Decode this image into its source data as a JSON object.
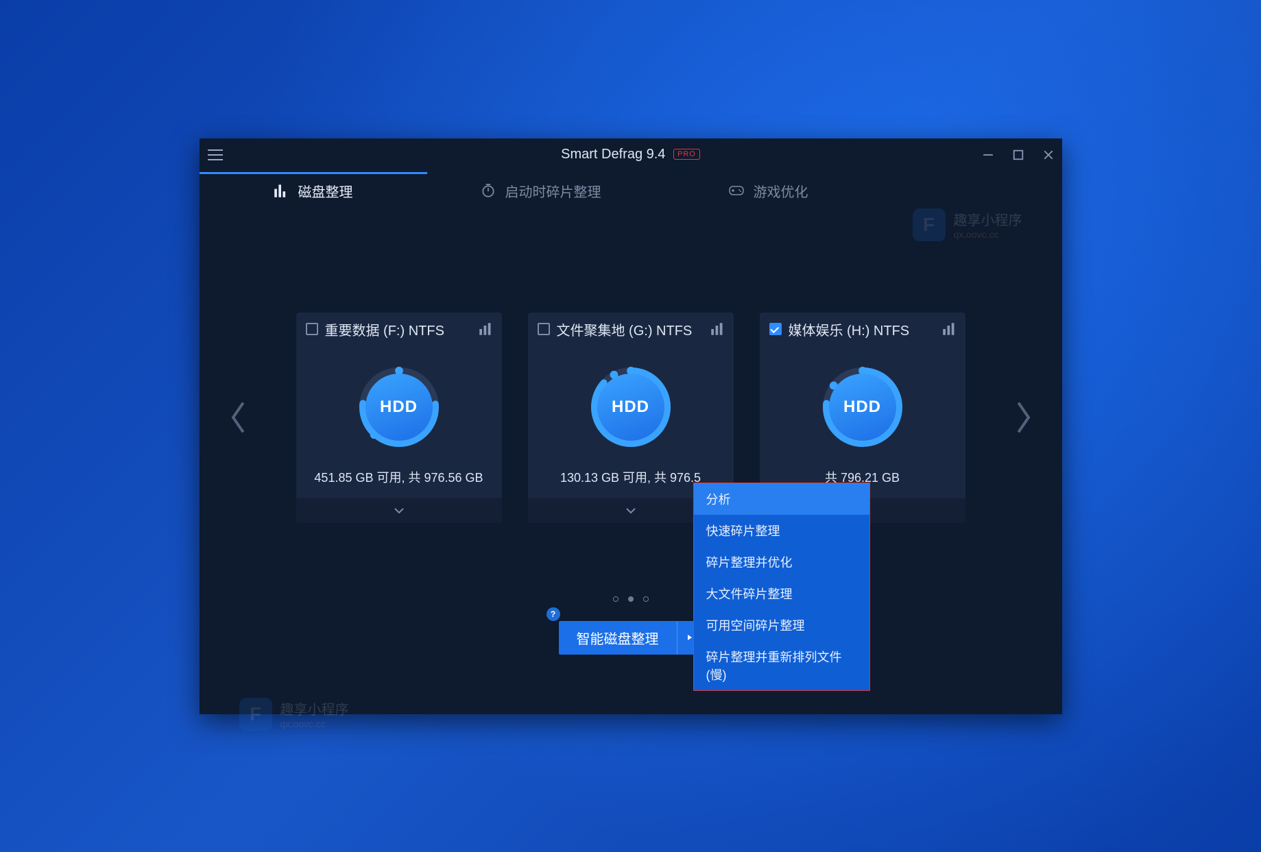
{
  "title": {
    "name": "Smart Defrag 9.4",
    "badge": "PRO"
  },
  "tabs": [
    {
      "label": "磁盘整理"
    },
    {
      "label": "启动时碎片整理"
    },
    {
      "label": "游戏优化"
    }
  ],
  "disks": [
    {
      "checked": false,
      "name": "重要数据 (F:) NTFS",
      "type": "HDD",
      "usage": "451.85 GB 可用, 共 976.56 GB"
    },
    {
      "checked": false,
      "name": "文件聚集地 (G:) NTFS",
      "type": "HDD",
      "usage": "130.13 GB 可用, 共 976.5"
    },
    {
      "checked": true,
      "name": "媒体娱乐 (H:) NTFS",
      "type": "HDD",
      "usage": "共 796.21 GB"
    }
  ],
  "primary_button": "智能磁盘整理",
  "menu": [
    "分析",
    "快速碎片整理",
    "碎片整理并优化",
    "大文件碎片整理",
    "可用空间碎片整理",
    "碎片整理并重新排列文件 (慢)"
  ],
  "watermark": {
    "brand": "趣享小程序",
    "url": "qx.oovc.cc",
    "letter": "F"
  },
  "help_char": "?"
}
